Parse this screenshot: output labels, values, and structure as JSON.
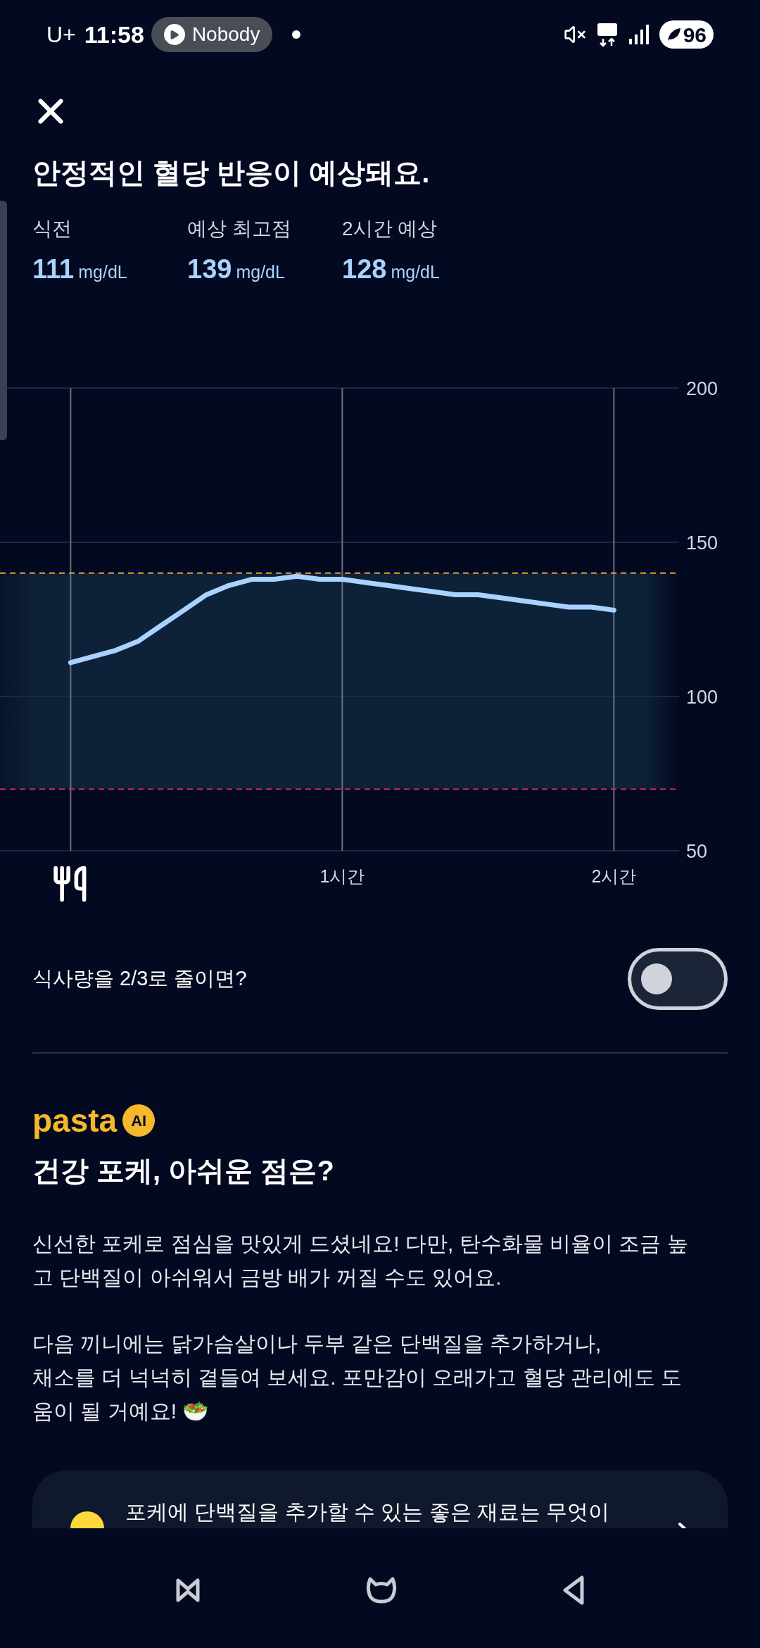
{
  "status_bar": {
    "carrier": "U+",
    "time": "11:58",
    "media_pill": "Nobody",
    "battery": "96"
  },
  "header": {
    "title": "안정적인 혈당 반응이 예상돼요."
  },
  "stats": [
    {
      "label": "식전",
      "value": "111",
      "unit": "mg/dL"
    },
    {
      "label": "예상 최고점",
      "value": "139",
      "unit": "mg/dL"
    },
    {
      "label": "2시간 예상",
      "value": "128",
      "unit": "mg/dL"
    }
  ],
  "chart": {
    "chart_data": {
      "type": "line",
      "grid": true,
      "xlim": [
        -0.26,
        2.24
      ],
      "ylim": [
        50,
        200
      ],
      "yticks": [
        50,
        100,
        150,
        200
      ],
      "xticks": [
        {
          "value": 1,
          "label": "1시간"
        },
        {
          "value": 2,
          "label": "2시간"
        }
      ],
      "x": [
        0,
        0.083,
        0.167,
        0.25,
        0.333,
        0.417,
        0.5,
        0.583,
        0.667,
        0.75,
        0.833,
        0.917,
        1,
        1.083,
        1.167,
        1.25,
        1.333,
        1.417,
        1.5,
        1.583,
        1.667,
        1.75,
        1.833,
        1.917,
        2
      ],
      "series": [
        {
          "color": "#a9d2ff",
          "values": [
            111,
            113,
            115,
            118,
            123,
            128,
            133,
            136,
            138,
            138,
            139,
            138,
            138,
            137,
            136,
            135,
            134,
            133,
            133,
            132,
            131,
            130,
            129,
            129,
            128
          ]
        }
      ],
      "ref_lines": [
        {
          "axis": "y",
          "value": 140,
          "color": "#f0a030"
        },
        {
          "axis": "y",
          "value": 70,
          "color": "#e0304a"
        }
      ],
      "bands": [
        {
          "axis": "y",
          "from": 70,
          "to": 140,
          "color": "#0d2139"
        }
      ]
    }
  },
  "portion_toggle": {
    "label": "식사량을 2/3로 줄이면?",
    "on": false
  },
  "ai_section": {
    "brand": "pasta",
    "badge": "AI",
    "title": "건강 포케, 아쉬운 점은?",
    "paragraphs": [
      "신선한 포케로 점심을 맛있게 드셨네요! 다만, 탄수화물 비율이 조금 높고 단백질이 아쉬워서 금방 배가 꺼질 수도 있어요.",
      "다음 끼니에는 닭가슴살이나 두부 같은 단백질을 추가하거나,\n채소를 더 넉넉히 곁들여 보세요. 포만감이 오래가고 혈당 관리에도 도움이 될 거예요! 🥗"
    ],
    "suggestion": "포케에 단백질을 추가할 수 있는 좋은 재료는 무엇이"
  }
}
